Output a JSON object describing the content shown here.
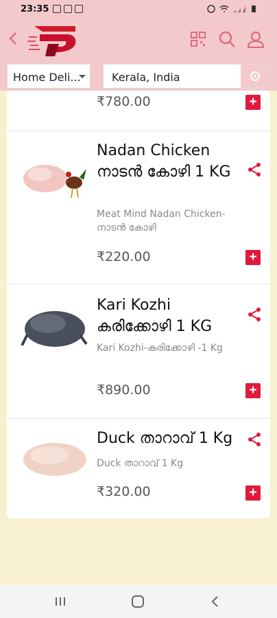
{
  "status_bar": {
    "time": "23:35"
  },
  "header": {
    "logo_icon": "store-logo-icon",
    "back_icon": "back-chevron-icon",
    "icons": [
      "qr-code-icon",
      "search-icon",
      "user-icon"
    ]
  },
  "filters": {
    "delivery_mode": "Home Deli...",
    "location_value": "Kerala, India"
  },
  "products": [
    {
      "name": "",
      "desc": "",
      "price": "₹780.00"
    },
    {
      "name": "Nadan Chicken നാടൻ കോഴി 1 KG",
      "desc": "Meat Mind Nadan Chicken-നാടൻ കോഴി",
      "price": "₹220.00"
    },
    {
      "name": "Kari Kozhi കരിക്കോഴി 1 KG",
      "desc": "Kari Kozhi-കരിക്കോഴി -1 Kg",
      "price": "₹890.00"
    },
    {
      "name": "Duck താറാവ് 1 Kg",
      "desc": "Duck താറാവ് 1 Kg",
      "price": "₹320.00"
    }
  ],
  "add_label": "+",
  "colors": {
    "header_bg": "#f3c9cc",
    "accent": "#e01a3c",
    "page_bg": "#f7f1cf"
  }
}
